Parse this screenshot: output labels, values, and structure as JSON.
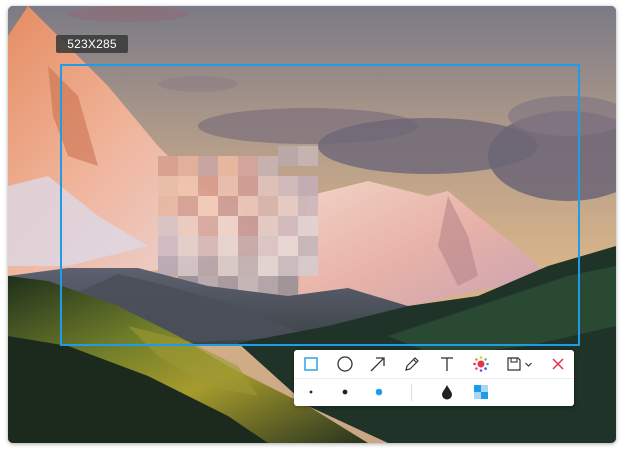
{
  "capture": {
    "size_label": "523X285",
    "selection_color": "#1f9ce8"
  },
  "toolbar": {
    "tools": [
      {
        "name": "rectangle",
        "icon": "square-icon",
        "active": true
      },
      {
        "name": "ellipse",
        "icon": "circle-icon"
      },
      {
        "name": "arrow",
        "icon": "arrow-icon"
      },
      {
        "name": "pen",
        "icon": "pencil-icon"
      },
      {
        "name": "text",
        "icon": "text-icon"
      },
      {
        "name": "color",
        "icon": "color-wheel-icon"
      },
      {
        "name": "save",
        "icon": "save-icon",
        "has_dropdown": true
      },
      {
        "name": "close",
        "icon": "close-icon",
        "color": "#e5334a"
      }
    ],
    "brush_sizes": [
      "small",
      "medium",
      "large"
    ],
    "selected_brush_size": "large",
    "options": [
      {
        "name": "blur",
        "icon": "water-drop-icon"
      },
      {
        "name": "mosaic",
        "icon": "mosaic-icon"
      }
    ],
    "accent_color": "#1f9ce8"
  }
}
